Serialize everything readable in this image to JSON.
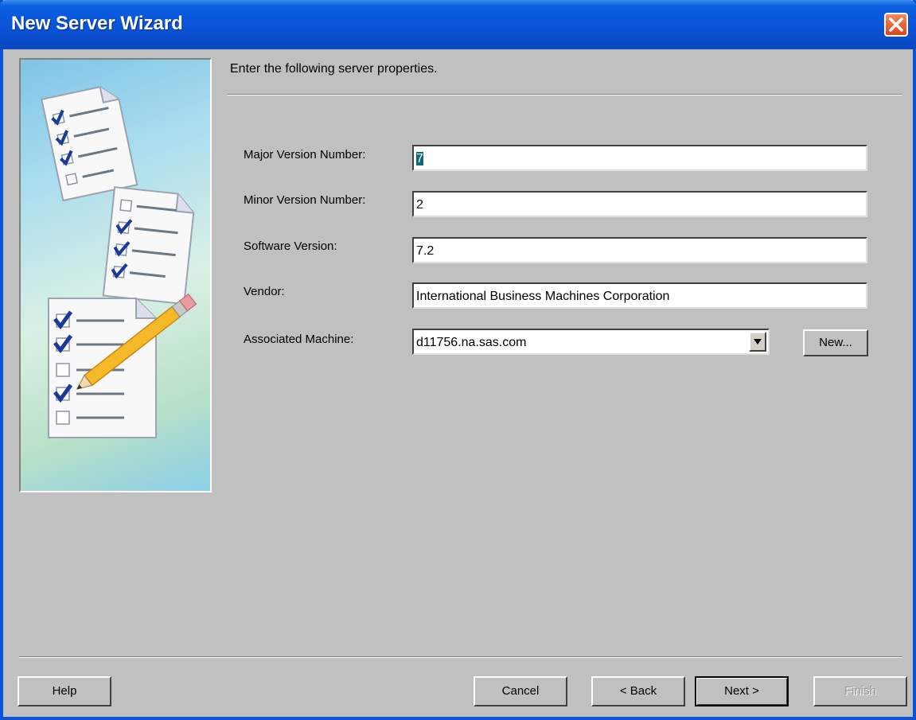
{
  "window": {
    "title": "New Server Wizard"
  },
  "instruction": "Enter the following server properties.",
  "fields": {
    "major": {
      "label": "Major Version Number:",
      "value": "7"
    },
    "minor": {
      "label": "Minor Version Number:",
      "value": "2"
    },
    "software": {
      "label": "Software Version:",
      "value": "7.2"
    },
    "vendor": {
      "label": "Vendor:",
      "value": "International Business Machines Corporation"
    },
    "machine": {
      "label": "Associated Machine:",
      "value": "d11756.na.sas.com"
    }
  },
  "buttons": {
    "new": "New...",
    "help": "Help",
    "cancel": "Cancel",
    "back": "< Back",
    "next": "Next >",
    "finish": "Finish"
  },
  "icons": {
    "close": "close-icon",
    "dropdown": "chevron-down-icon",
    "illustration": "checklist-documents-pencil-illustration"
  },
  "colors": {
    "titlebar": "#0a52d6",
    "dialog_bg": "#c0c0c0",
    "close_button": "#d8451f",
    "selection": "#0a6a7a"
  }
}
